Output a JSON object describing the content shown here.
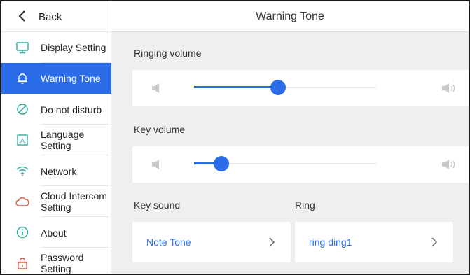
{
  "header": {
    "title": "Warning Tone"
  },
  "back": {
    "label": "Back"
  },
  "sidebar": {
    "items": [
      {
        "label": "Display Setting",
        "icon": "monitor-icon"
      },
      {
        "label": "Warning Tone",
        "icon": "bell-icon",
        "active": true
      },
      {
        "label": "Do not disturb",
        "icon": "do-not-disturb-icon"
      },
      {
        "label": "Language Setting",
        "icon": "language-icon"
      },
      {
        "label": "Network",
        "icon": "wifi-icon"
      },
      {
        "label": "Cloud Intercom Setting",
        "icon": "cloud-icon"
      },
      {
        "label": "About",
        "icon": "info-icon"
      },
      {
        "label": "Password Setting",
        "icon": "lock-icon"
      }
    ]
  },
  "ringing_volume": {
    "label": "Ringing volume",
    "level": 0.46
  },
  "key_volume": {
    "label": "Key volume",
    "level": 0.15
  },
  "key_sound": {
    "label": "Key sound",
    "value": "Note Tone"
  },
  "ring": {
    "label": "Ring",
    "value": "ring ding1"
  },
  "colors": {
    "accent": "#2b6de8",
    "content_bg": "#efefef",
    "icon_gray": "#c8c8c8",
    "sidebar_icon": "#2aa89a",
    "cloud_icon": "#e0533c"
  }
}
